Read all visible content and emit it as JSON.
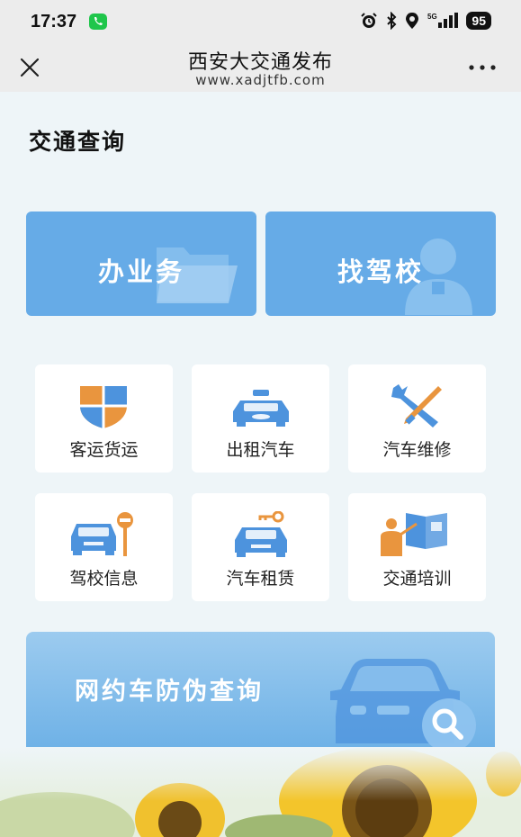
{
  "status_bar": {
    "time": "17:37",
    "battery": "95",
    "network": "5G"
  },
  "header": {
    "title": "西安大交通发布",
    "url": "www.xadjtfb.com"
  },
  "section": {
    "title": "交通查询"
  },
  "big_cards": [
    {
      "label": "办业务",
      "icon": "folder-icon"
    },
    {
      "label": "找驾校",
      "icon": "person-icon"
    }
  ],
  "tiles": [
    {
      "label": "客运货运",
      "icon": "shield-icon"
    },
    {
      "label": "出租汽车",
      "icon": "taxi-icon"
    },
    {
      "label": "汽车维修",
      "icon": "wrench-screwdriver-icon"
    },
    {
      "label": "驾校信息",
      "icon": "car-sign-icon"
    },
    {
      "label": "汽车租赁",
      "icon": "car-key-icon"
    },
    {
      "label": "交通培训",
      "icon": "book-teacher-icon"
    }
  ],
  "banner": {
    "label": "网约车防伪查询",
    "icon": "car-search-icon"
  },
  "colors": {
    "accent": "#66abe7",
    "orange": "#e9953e",
    "blue_icon": "#4d93dd"
  }
}
